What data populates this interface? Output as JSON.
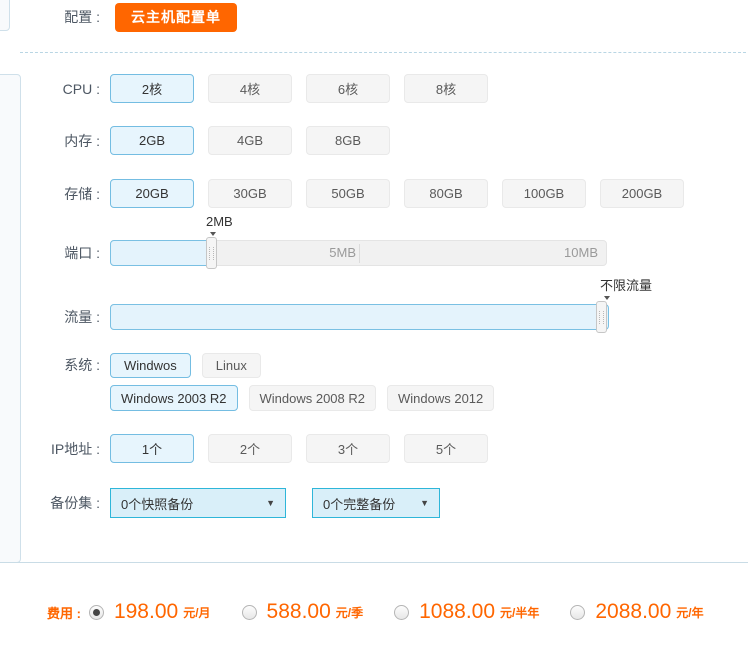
{
  "colors": {
    "accent_orange": "#ff6600",
    "selected_bg": "#e7f5fd",
    "selected_border": "#74bde2",
    "dropdown_bg": "#d9eff9",
    "dropdown_border": "#2eb6d9",
    "price_color": "#ff6600"
  },
  "icons": {
    "dropdown_arrow": "▼"
  },
  "config": {
    "label": "配置 :",
    "button_label": "云主机配置单"
  },
  "cpu": {
    "label": "CPU :",
    "options": [
      "2核",
      "4核",
      "6核",
      "8核"
    ],
    "selected_index": 0
  },
  "memory": {
    "label": "内存 :",
    "options": [
      "2GB",
      "4GB",
      "8GB"
    ],
    "selected_index": 0
  },
  "storage": {
    "label": "存储 :",
    "options": [
      "20GB",
      "30GB",
      "50GB",
      "80GB",
      "100GB",
      "200GB"
    ],
    "selected_index": 0
  },
  "port": {
    "label": "端口 :",
    "value_tooltip": "2MB",
    "mid_label": "5MB",
    "max_label": "10MB"
  },
  "traffic": {
    "label": "流量 :",
    "value_tooltip": "不限流量"
  },
  "system": {
    "label": "系统 :",
    "families": [
      {
        "label": "Windwos",
        "selected": true
      },
      {
        "label": "Linux",
        "selected": false
      }
    ],
    "versions": [
      {
        "label": "Windows 2003 R2",
        "selected": true
      },
      {
        "label": "Windows 2008 R2",
        "selected": false
      },
      {
        "label": "Windows 2012",
        "selected": false
      }
    ]
  },
  "ip": {
    "label": "IP地址 :",
    "options": [
      "1个",
      "2个",
      "3个",
      "5个"
    ],
    "selected_index": 0
  },
  "backup": {
    "label": "备份集 :",
    "selects": [
      {
        "value": "0个快照备份"
      },
      {
        "value": "0个完整备份"
      }
    ]
  },
  "fee": {
    "label": "费用 :",
    "plans": [
      {
        "price": "198.00",
        "unit": "元/月",
        "selected": true
      },
      {
        "price": "588.00",
        "unit": "元/季",
        "selected": false
      },
      {
        "price": "1088.00",
        "unit": "元/半年",
        "selected": false
      },
      {
        "price": "2088.00",
        "unit": "元/年",
        "selected": false
      }
    ]
  }
}
